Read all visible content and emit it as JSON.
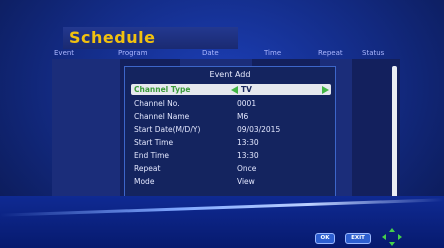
{
  "title": "Schedule",
  "columns": [
    "Event",
    "Program",
    "Date",
    "Time",
    "Repeat",
    "Status"
  ],
  "dialog": {
    "title": "Event Add",
    "rows": [
      {
        "label": "Channel Type",
        "value": "TV"
      },
      {
        "label": "Channel No.",
        "value": "0001"
      },
      {
        "label": "Channel Name",
        "value": "M6"
      },
      {
        "label": "Start Date(M/D/Y)",
        "value": "09/03/2015"
      },
      {
        "label": "Start Time",
        "value": "13:30"
      },
      {
        "label": "End Time",
        "value": "13:30"
      },
      {
        "label": "Repeat",
        "value": "Once"
      },
      {
        "label": "Mode",
        "value": "View"
      }
    ]
  },
  "buttons": {
    "ok": "OK",
    "exit": "EXIT"
  },
  "icons": {
    "nav": "arrow-keys-icon",
    "prev": "arrow-left-icon",
    "next": "arrow-right-icon"
  },
  "colors": {
    "accent_title": "#f1c10f",
    "selected_label": "#3a9a3a",
    "arrow": "#43b546"
  }
}
